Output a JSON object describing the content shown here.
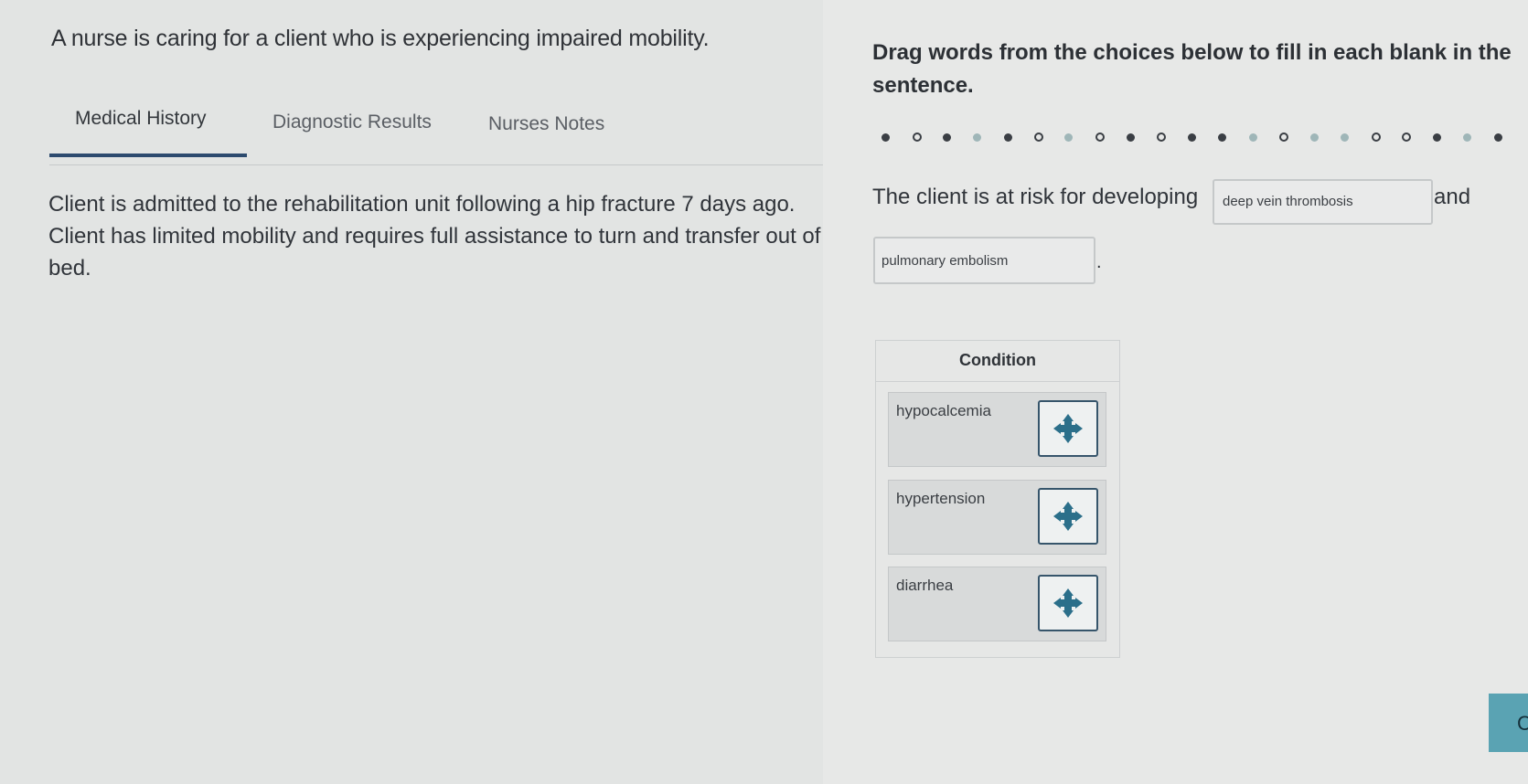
{
  "question": {
    "stem": "A nurse is caring for a client who is experiencing impaired mobility."
  },
  "tabs": [
    {
      "label": "Medical History",
      "active": true
    },
    {
      "label": "Diagnostic Results",
      "active": false
    },
    {
      "label": "Nurses Notes",
      "active": false
    }
  ],
  "medical_history": {
    "text": "Client is admitted to the rehabilitation unit following a hip fracture 7 days ago.  Client has limited mobility and requires full assistance to turn and transfer out of bed."
  },
  "instructions": {
    "line1": "Drag words from the choices below to fill in each blank in the",
    "line2": "sentence."
  },
  "sentence": {
    "part1": "The client is at risk for developing",
    "blank1_value": "deep vein thrombosis",
    "part2": "and",
    "blank2_value": "pulmonary embolism",
    "end": "."
  },
  "choices": {
    "header": "Condition",
    "items": [
      {
        "label": "hypocalcemia"
      },
      {
        "label": "hypertension"
      },
      {
        "label": "diarrhea"
      }
    ]
  },
  "continue_button": {
    "label": "C"
  },
  "colors": {
    "accent": "#2c4a6e",
    "handle_icon": "#2b6f8a",
    "continue_button": "#5aa3b3"
  },
  "icons": {
    "drag_handle": "move-arrows-icon"
  }
}
